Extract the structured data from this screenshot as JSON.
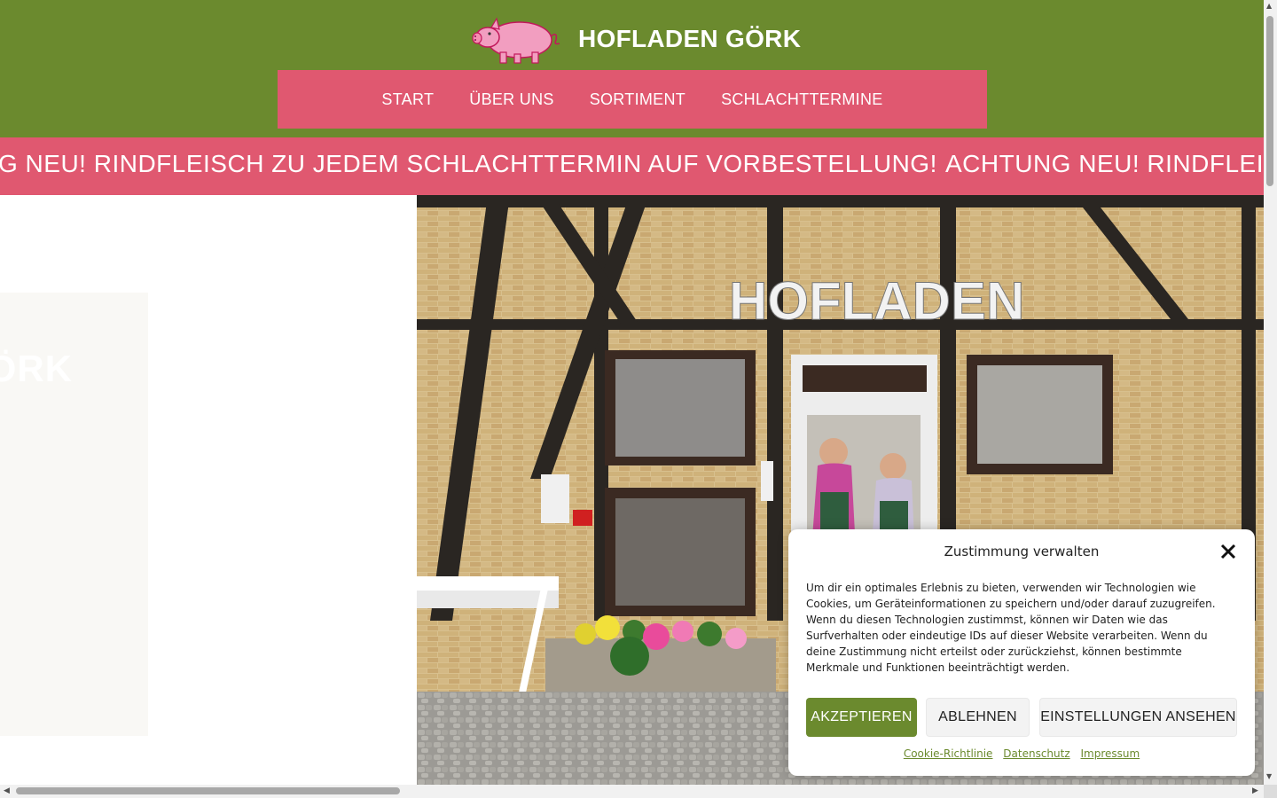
{
  "header": {
    "site_title": "HOFLADEN GÖRK",
    "logo_icon": "pig-logo-icon"
  },
  "nav": {
    "items": [
      {
        "label": "START"
      },
      {
        "label": "ÜBER UNS"
      },
      {
        "label": "SORTIMENT"
      },
      {
        "label": "SCHLACHTTERMINE"
      }
    ]
  },
  "ticker": {
    "text_a": "G NEU! RINDFLEISCH ZU JEDEM SCHLACHTTERMIN AUF VORBESTELLUNG!",
    "text_b": "ACHTUNG NEU! RINDFLEIS"
  },
  "slider": {
    "ghost_text": "GÖRK"
  },
  "photo": {
    "sign_text": "HOFLADEN"
  },
  "cookie": {
    "title": "Zustimmung verwalten",
    "body": "Um dir ein optimales Erlebnis zu bieten, verwenden wir Technologien wie Cookies, um Geräteinformationen zu speichern und/oder darauf zuzugreifen. Wenn du diesen Technologien zustimmst, können wir Daten wie das Surfverhalten oder eindeutige IDs auf dieser Website verarbeiten. Wenn du deine Zustimmung nicht erteilst oder zurückziehst, können bestimmte Merkmale und Funktionen beeinträchtigt werden.",
    "accept_label": "AKZEPTIEREN",
    "deny_label": "ABLEHNEN",
    "prefs_label": "EINSTELLUNGEN ANSEHEN",
    "links": {
      "cookie_policy": "Cookie-Richtlinie",
      "privacy": "Datenschutz",
      "imprint": "Impressum"
    }
  },
  "colors": {
    "header_green": "#6b8a2e",
    "accent_pink": "#e05870"
  }
}
